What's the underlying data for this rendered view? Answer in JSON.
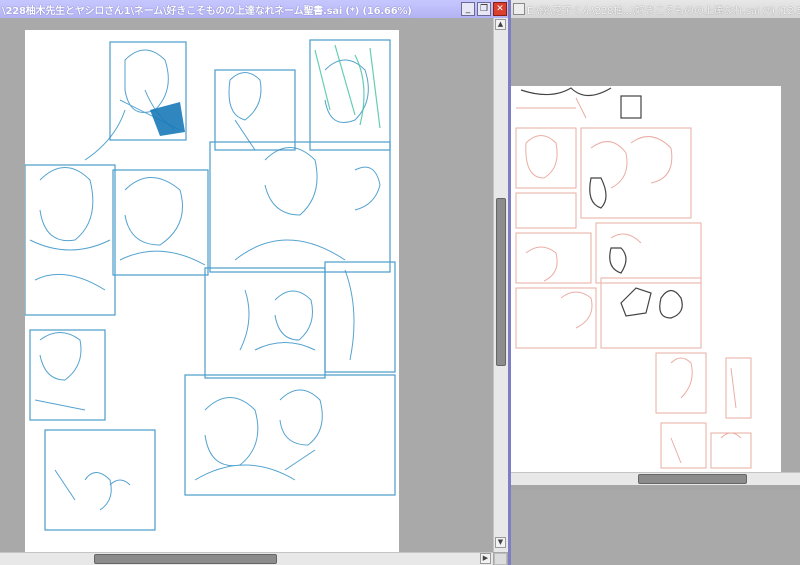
{
  "left_window": {
    "title": "\\228柚木先生とヤシロさん1\\ネーム\\好きこそものの上達なれネーム聖書.sai (*) (16.66%)",
    "buttons": {
      "minimize": "_",
      "restore": "❐",
      "close": "✕"
    }
  },
  "right_window": {
    "title": "E:\\絵\\花子くん\\228柚...\\好きこそものの上達なれ.sai (*) (12.5%)"
  },
  "scroll": {
    "up": "▲",
    "down": "▼",
    "left": "◀",
    "right": "▶"
  },
  "colors": {
    "sketch_blue": "#2b8cc4",
    "sketch_teal": "#3fc0a0",
    "sketch_red": "#e8a59a",
    "title_active": "#b8b8f5",
    "title_inactive": "#dcdcdc"
  }
}
